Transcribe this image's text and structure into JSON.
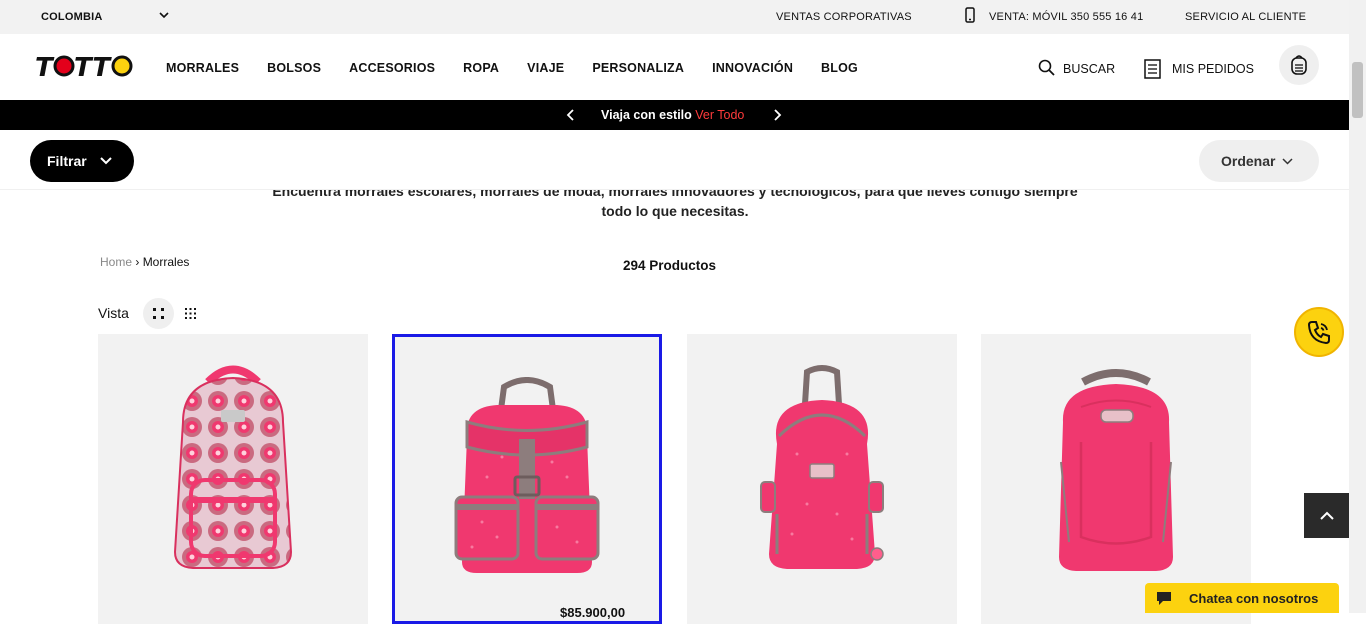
{
  "topbar": {
    "country": "COLOMBIA",
    "corporate": "VENTAS CORPORATIVAS",
    "phone": "VENTA: MÓVIL 350 555 16 41",
    "service": "SERVICIO AL CLIENTE"
  },
  "header": {
    "logo_text": "TOTTO",
    "nav": [
      "MORRALES",
      "BOLSOS",
      "ACCESORIOS",
      "ROPA",
      "VIAJE",
      "PERSONALIZA",
      "INNOVACIÓN",
      "BLOG"
    ],
    "search_label": "BUSCAR",
    "orders_label": "MIS PEDIDOS"
  },
  "promo": {
    "text": "Viaja con estilo",
    "link": "Ver Todo"
  },
  "filters": {
    "filter_label": "Filtrar",
    "sort_label": "Ordenar"
  },
  "category": {
    "description": "Encuentra morrales escolares, morrales de moda, morrales innovadores y tecnológicos, para que lleves contigo siempre todo lo que necesitas.",
    "breadcrumb_home": "Home",
    "breadcrumb_current": "Morrales",
    "product_count": "294 Productos",
    "view_label": "Vista"
  },
  "products": [
    {
      "price": ""
    },
    {
      "price": "$85.900,00"
    },
    {
      "price": ""
    },
    {
      "price": ""
    }
  ],
  "widgets": {
    "chat_label": "Chatea con nosotros"
  },
  "colors": {
    "accent_yellow": "#fcd20f",
    "promo_link": "#ff3b3b",
    "product_pink": "#f0386f"
  }
}
